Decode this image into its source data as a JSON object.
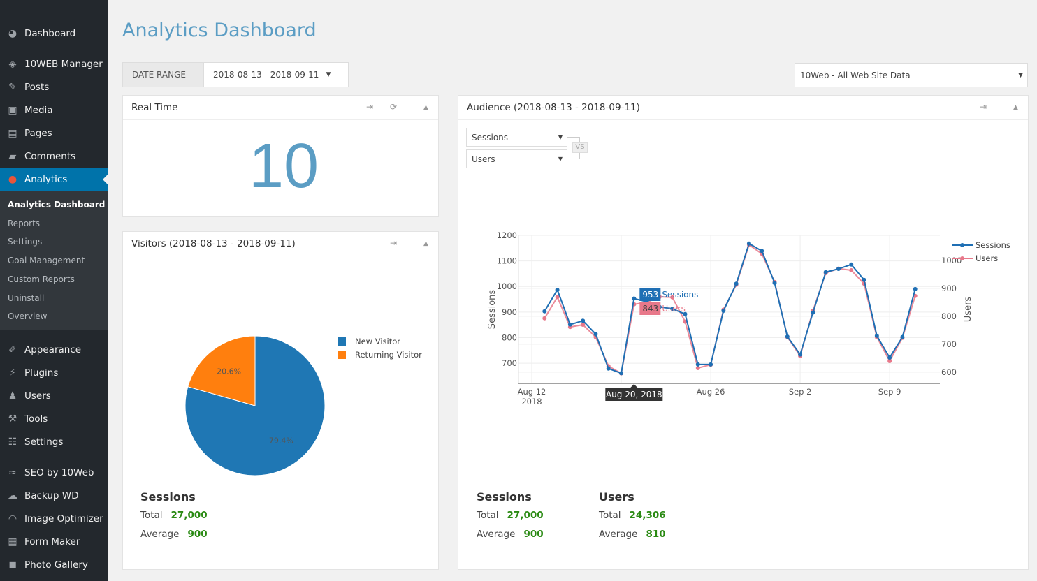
{
  "sidebar": {
    "items": [
      {
        "label": "Dashboard",
        "icon": "dashboard-icon",
        "glyph": "◕"
      },
      {
        "label": "10WEB Manager",
        "icon": "10web-icon",
        "glyph": "◈"
      },
      {
        "label": "Posts",
        "icon": "pin-icon",
        "glyph": "✎"
      },
      {
        "label": "Media",
        "icon": "media-icon",
        "glyph": "▣"
      },
      {
        "label": "Pages",
        "icon": "pages-icon",
        "glyph": "▤"
      },
      {
        "label": "Comments",
        "icon": "comment-icon",
        "glyph": "▰"
      },
      {
        "label": "Analytics",
        "icon": "analytics-icon",
        "glyph": "●"
      },
      {
        "label": "Appearance",
        "icon": "brush-icon",
        "glyph": "✐"
      },
      {
        "label": "Plugins",
        "icon": "plug-icon",
        "glyph": "⚡"
      },
      {
        "label": "Users",
        "icon": "user-icon",
        "glyph": "♟"
      },
      {
        "label": "Tools",
        "icon": "wrench-icon",
        "glyph": "⚒"
      },
      {
        "label": "Settings",
        "icon": "settings-icon",
        "glyph": "☷"
      },
      {
        "label": "SEO by 10Web",
        "icon": "seo-icon",
        "glyph": "≈"
      },
      {
        "label": "Backup WD",
        "icon": "cloud-icon",
        "glyph": "☁"
      },
      {
        "label": "Image Optimizer",
        "icon": "gauge-icon",
        "glyph": "◠"
      },
      {
        "label": "Form Maker",
        "icon": "form-icon",
        "glyph": "▦"
      },
      {
        "label": "Photo Gallery",
        "icon": "gallery-icon",
        "glyph": "◼"
      }
    ],
    "submenu": [
      "Analytics Dashboard",
      "Reports",
      "Settings",
      "Goal Management",
      "Custom Reports",
      "Uninstall",
      "Overview"
    ]
  },
  "page": {
    "title": "Analytics Dashboard",
    "date_range_label": "DATE RANGE",
    "date_range": "2018-08-13 - 2018-09-11",
    "site_select": "10Web - All Web Site Data"
  },
  "realtime": {
    "title": "Real Time",
    "value": "10"
  },
  "visitors": {
    "title": "Visitors (2018-08-13 - 2018-09-11)",
    "sessions_heading": "Sessions",
    "total_label": "Total",
    "total": "27,000",
    "average_label": "Average",
    "average": "900"
  },
  "audience": {
    "title": "Audience (2018-08-13 - 2018-09-11)",
    "metric1": "Sessions",
    "metric2": "Users",
    "vs": "VS",
    "sessions_heading": "Sessions",
    "sessions_total": "27,000",
    "sessions_average": "900",
    "users_heading": "Users",
    "users_total": "24,306",
    "users_average": "810",
    "total_label": "Total",
    "average_label": "Average",
    "tooltip": {
      "date": "Aug 20, 2018",
      "sessions_value": "953",
      "sessions_label": "Sessions",
      "users_value": "843",
      "users_label": "Users"
    }
  },
  "chart_data": [
    {
      "type": "pie",
      "categories": [
        "New Visitor",
        "Returning Visitor"
      ],
      "values": [
        79.4,
        20.6
      ],
      "labels": [
        "79.4%",
        "20.6%"
      ],
      "colors": [
        "#1f77b4",
        "#ff7f0e"
      ],
      "legend": "right"
    },
    {
      "type": "line",
      "x": [
        "2018-08-13",
        "2018-08-14",
        "2018-08-15",
        "2018-08-16",
        "2018-08-17",
        "2018-08-18",
        "2018-08-19",
        "2018-08-20",
        "2018-08-21",
        "2018-08-22",
        "2018-08-23",
        "2018-08-24",
        "2018-08-25",
        "2018-08-26",
        "2018-08-27",
        "2018-08-28",
        "2018-08-29",
        "2018-08-30",
        "2018-08-31",
        "2018-09-01",
        "2018-09-02",
        "2018-09-03",
        "2018-09-04",
        "2018-09-05",
        "2018-09-06",
        "2018-09-07",
        "2018-09-08",
        "2018-09-09",
        "2018-09-10",
        "2018-09-11"
      ],
      "xticks": [
        {
          "date": "2018-08-12",
          "label": "Aug 12",
          "sub": "2018"
        },
        {
          "date": "2018-08-19",
          "label": ""
        },
        {
          "date": "2018-08-26",
          "label": "Aug 26"
        },
        {
          "date": "2018-09-02",
          "label": "Sep 2"
        },
        {
          "date": "2018-09-09",
          "label": "Sep 9"
        }
      ],
      "series": [
        {
          "name": "Sessions",
          "axis": "left",
          "color": "#1f6fb4",
          "values": [
            903,
            987,
            851,
            866,
            814,
            679,
            661,
            953,
            940,
            920,
            913,
            892,
            695,
            695,
            905,
            1011,
            1168,
            1139,
            1014,
            804,
            734,
            898,
            1056,
            1069,
            1086,
            1026,
            807,
            722,
            802,
            990
          ]
        },
        {
          "name": "Users",
          "axis": "right",
          "color": "#e8788a",
          "values": [
            793,
            869,
            762,
            770,
            726,
            622,
            596,
            843,
            850,
            870,
            868,
            781,
            615,
            627,
            824,
            913,
            1056,
            1024,
            923,
            726,
            658,
            820,
            955,
            971,
            965,
            917,
            726,
            640,
            723,
            873
          ]
        }
      ],
      "ylabel": "Sessions",
      "y2label": "Users",
      "ylim": [
        621,
        1200
      ],
      "y2lim": [
        560,
        1090
      ],
      "yticks": [
        700,
        800,
        900,
        1000,
        1100,
        1200
      ],
      "y2ticks": [
        600,
        700,
        800,
        900,
        1000
      ],
      "grid": true,
      "legend": "top-right"
    }
  ]
}
